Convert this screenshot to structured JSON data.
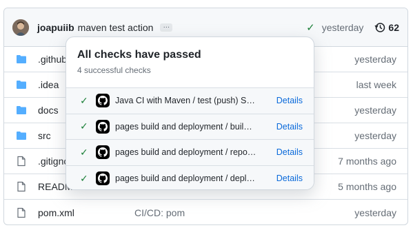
{
  "header": {
    "author": "joapuiib",
    "message": "maven test action",
    "ellipsis": "…",
    "status_icon": "check-icon",
    "time": "yesterday",
    "commit_count": "62"
  },
  "files": [
    {
      "name": ".github",
      "type": "folder",
      "commit": "",
      "age": "yesterday"
    },
    {
      "name": ".idea",
      "type": "folder",
      "commit": "",
      "age": "last week"
    },
    {
      "name": "docs",
      "type": "folder",
      "commit": "",
      "age": "yesterday"
    },
    {
      "name": "src",
      "type": "folder",
      "commit": "",
      "age": "yesterday"
    },
    {
      "name": ".gitignore",
      "type": "file",
      "commit": "",
      "age": "7 months ago"
    },
    {
      "name": "README.md",
      "type": "file",
      "commit": "",
      "age": "5 months ago"
    },
    {
      "name": "pom.xml",
      "type": "file",
      "commit": "CI/CD: pom",
      "age": "yesterday"
    }
  ],
  "popover": {
    "title": "All checks have passed",
    "subtitle": "4 successful checks",
    "checks": [
      {
        "label": "Java CI with Maven / test (push) S…",
        "details": "Details"
      },
      {
        "label": "pages build and deployment / buil…",
        "details": "Details"
      },
      {
        "label": "pages build and deployment / repo…",
        "details": "Details"
      },
      {
        "label": "pages build and deployment / depl…",
        "details": "Details"
      }
    ]
  },
  "colors": {
    "success": "#1a7f37",
    "link": "#0969da",
    "folder": "#54aeff"
  }
}
